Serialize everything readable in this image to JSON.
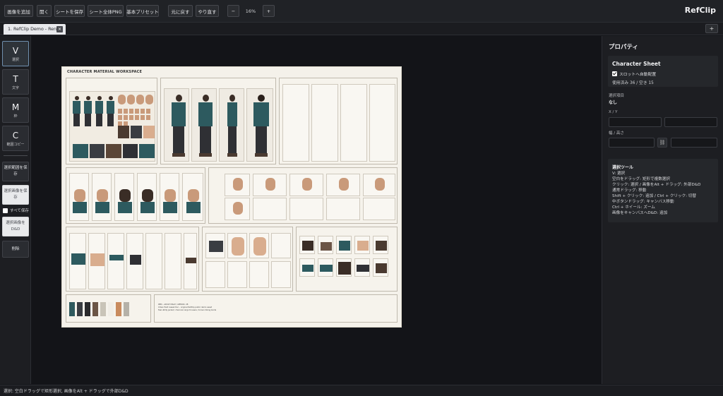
{
  "toolbar": {
    "add_image": "画像を追加",
    "open": "開く",
    "save_sheet": "シートを保存",
    "export_png": "シート全体PNG",
    "preset": "基本プリセット",
    "undo": "元に戻す",
    "redo": "やり直す",
    "zoom_out": "−",
    "zoom": "16%",
    "zoom_in": "+",
    "app_title": "RefClip"
  },
  "tabs": {
    "items": [
      {
        "label": "1. RefClip Demo - Ren"
      }
    ],
    "close": "×",
    "add": "+"
  },
  "tools": [
    {
      "key": "V",
      "label": "選択"
    },
    {
      "key": "T",
      "label": "文字"
    },
    {
      "key": "M",
      "label": "枠"
    },
    {
      "key": "C",
      "label": "範囲コピー"
    }
  ],
  "side_actions": {
    "save_selection": "選択範囲を保存",
    "save_selected_images": "選択画像を保存",
    "save_all": "すべて保存",
    "drag_selected": "選択画像をD&D",
    "delete": "削除"
  },
  "sheet": {
    "title": "CHARACTER MATERIAL WORKSPACE",
    "notes": [
      "REN – ADULT MALE / APPROX. 28",
      "Urban field researcher – original RefClip public demo asset",
      "Teal utility jacket / charcoal cargo trousers / brown hiking boots"
    ],
    "swatches": [
      "#2f5a5e",
      "#3a3d42",
      "#2a2a2c",
      "#6b5546",
      "#c9c4b8",
      "#f1eee7",
      "#c98b5e",
      "#b5b1a8"
    ]
  },
  "properties": {
    "title": "プロパティ",
    "card_title": "Character Sheet",
    "auto_place": "スロットへ自動配置",
    "usage": "使用済み 36 / 空き 15",
    "selected_label": "選択項目",
    "selected_value": "なし",
    "xy_label": "X / Y",
    "wh_label": "幅 / 高さ",
    "help_title": "選択ツール",
    "help_lines": [
      "V: 選択",
      "空白をドラッグ: 矩形で複数選択",
      "クリック: 選択 / 画像をAlt + ドラッグ: 外部D&D",
      "通常ドラッグ: 移動",
      "Shift + クリック: 追加 / Ctrl + クリック: 切替",
      "中ボタンドラッグ: キャンバス移動",
      "Ctrl + ホイール: ズーム",
      "画像をキャンバスへD&D: 追加"
    ]
  },
  "status": "選択: 空白ドラッグで矩形選択, 画像をAlt + ドラッグで外部D&D"
}
